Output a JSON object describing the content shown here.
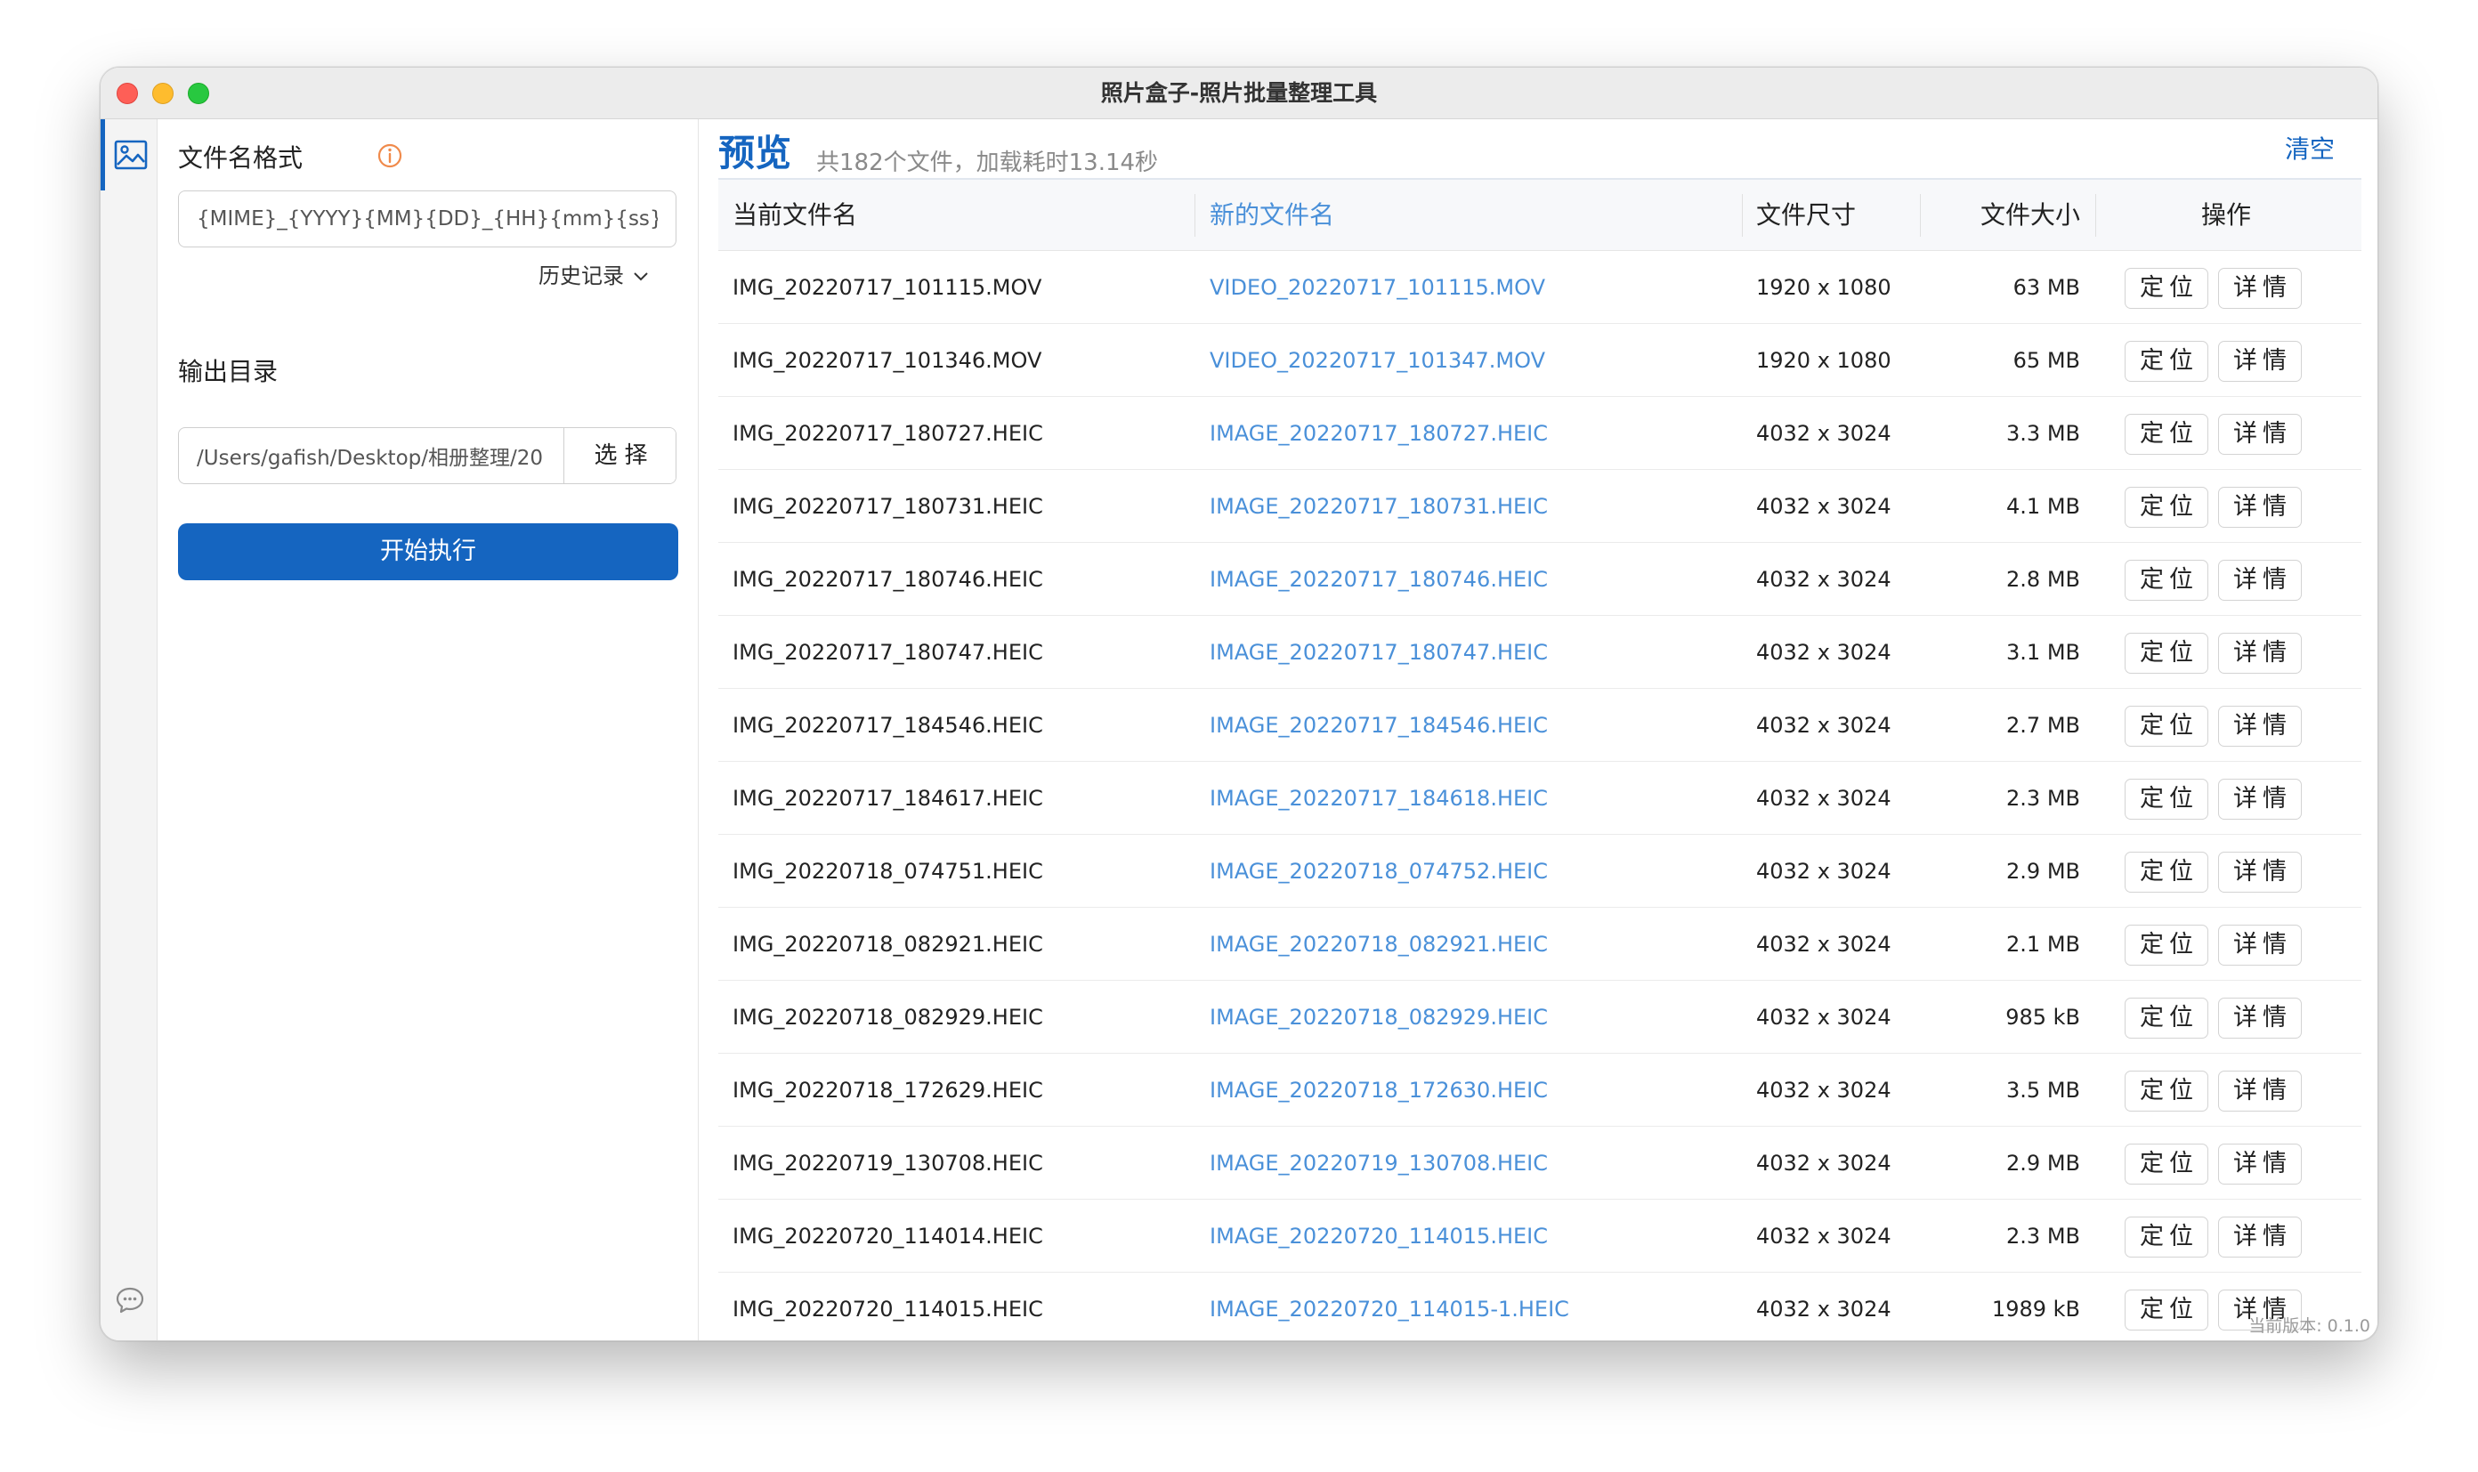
{
  "window": {
    "title": "照片盒子-照片批量整理工具"
  },
  "icons": {
    "photo": "photo-icon",
    "chat": "chat-icon",
    "info": "info-icon",
    "chevron": "chevron-down-icon"
  },
  "left_panel": {
    "format_label": "文件名格式",
    "format_value": "{MIME}_{YYYY}{MM}{DD}_{HH}{mm}{ss}",
    "history_label": "历史记录",
    "output_label": "输出目录",
    "output_value": "/Users/gafish/Desktop/相册整理/20",
    "choose_label": "选择",
    "run_label": "开始执行"
  },
  "preview": {
    "title": "预览",
    "subtitle": "共182个文件，加载耗时13.14秒",
    "clear_label": "清空"
  },
  "table": {
    "columns": [
      "当前文件名",
      "新的文件名",
      "文件尺寸",
      "文件大小",
      "操作"
    ],
    "locate_label": "定位",
    "detail_label": "详情",
    "rows": [
      {
        "old": "IMG_20220717_101115.MOV",
        "new": "VIDEO_20220717_101115.MOV",
        "dim": "1920 x 1080",
        "size": "63 MB"
      },
      {
        "old": "IMG_20220717_101346.MOV",
        "new": "VIDEO_20220717_101347.MOV",
        "dim": "1920 x 1080",
        "size": "65 MB"
      },
      {
        "old": "IMG_20220717_180727.HEIC",
        "new": "IMAGE_20220717_180727.HEIC",
        "dim": "4032 x 3024",
        "size": "3.3 MB"
      },
      {
        "old": "IMG_20220717_180731.HEIC",
        "new": "IMAGE_20220717_180731.HEIC",
        "dim": "4032 x 3024",
        "size": "4.1 MB"
      },
      {
        "old": "IMG_20220717_180746.HEIC",
        "new": "IMAGE_20220717_180746.HEIC",
        "dim": "4032 x 3024",
        "size": "2.8 MB"
      },
      {
        "old": "IMG_20220717_180747.HEIC",
        "new": "IMAGE_20220717_180747.HEIC",
        "dim": "4032 x 3024",
        "size": "3.1 MB"
      },
      {
        "old": "IMG_20220717_184546.HEIC",
        "new": "IMAGE_20220717_184546.HEIC",
        "dim": "4032 x 3024",
        "size": "2.7 MB"
      },
      {
        "old": "IMG_20220717_184617.HEIC",
        "new": "IMAGE_20220717_184618.HEIC",
        "dim": "4032 x 3024",
        "size": "2.3 MB"
      },
      {
        "old": "IMG_20220718_074751.HEIC",
        "new": "IMAGE_20220718_074752.HEIC",
        "dim": "4032 x 3024",
        "size": "2.9 MB"
      },
      {
        "old": "IMG_20220718_082921.HEIC",
        "new": "IMAGE_20220718_082921.HEIC",
        "dim": "4032 x 3024",
        "size": "2.1 MB"
      },
      {
        "old": "IMG_20220718_082929.HEIC",
        "new": "IMAGE_20220718_082929.HEIC",
        "dim": "4032 x 3024",
        "size": "985 kB"
      },
      {
        "old": "IMG_20220718_172629.HEIC",
        "new": "IMAGE_20220718_172630.HEIC",
        "dim": "4032 x 3024",
        "size": "3.5 MB"
      },
      {
        "old": "IMG_20220719_130708.HEIC",
        "new": "IMAGE_20220719_130708.HEIC",
        "dim": "4032 x 3024",
        "size": "2.9 MB"
      },
      {
        "old": "IMG_20220720_114014.HEIC",
        "new": "IMAGE_20220720_114015.HEIC",
        "dim": "4032 x 3024",
        "size": "2.3 MB"
      },
      {
        "old": "IMG_20220720_114015.HEIC",
        "new": "IMAGE_20220720_114015-1.HEIC",
        "dim": "4032 x 3024",
        "size": "1989 kB"
      }
    ]
  },
  "version_text": "当前版本: 0.1.0",
  "colors": {
    "accent": "#1565c0",
    "link": "#4a90d9",
    "warning": "#f08a4b"
  }
}
